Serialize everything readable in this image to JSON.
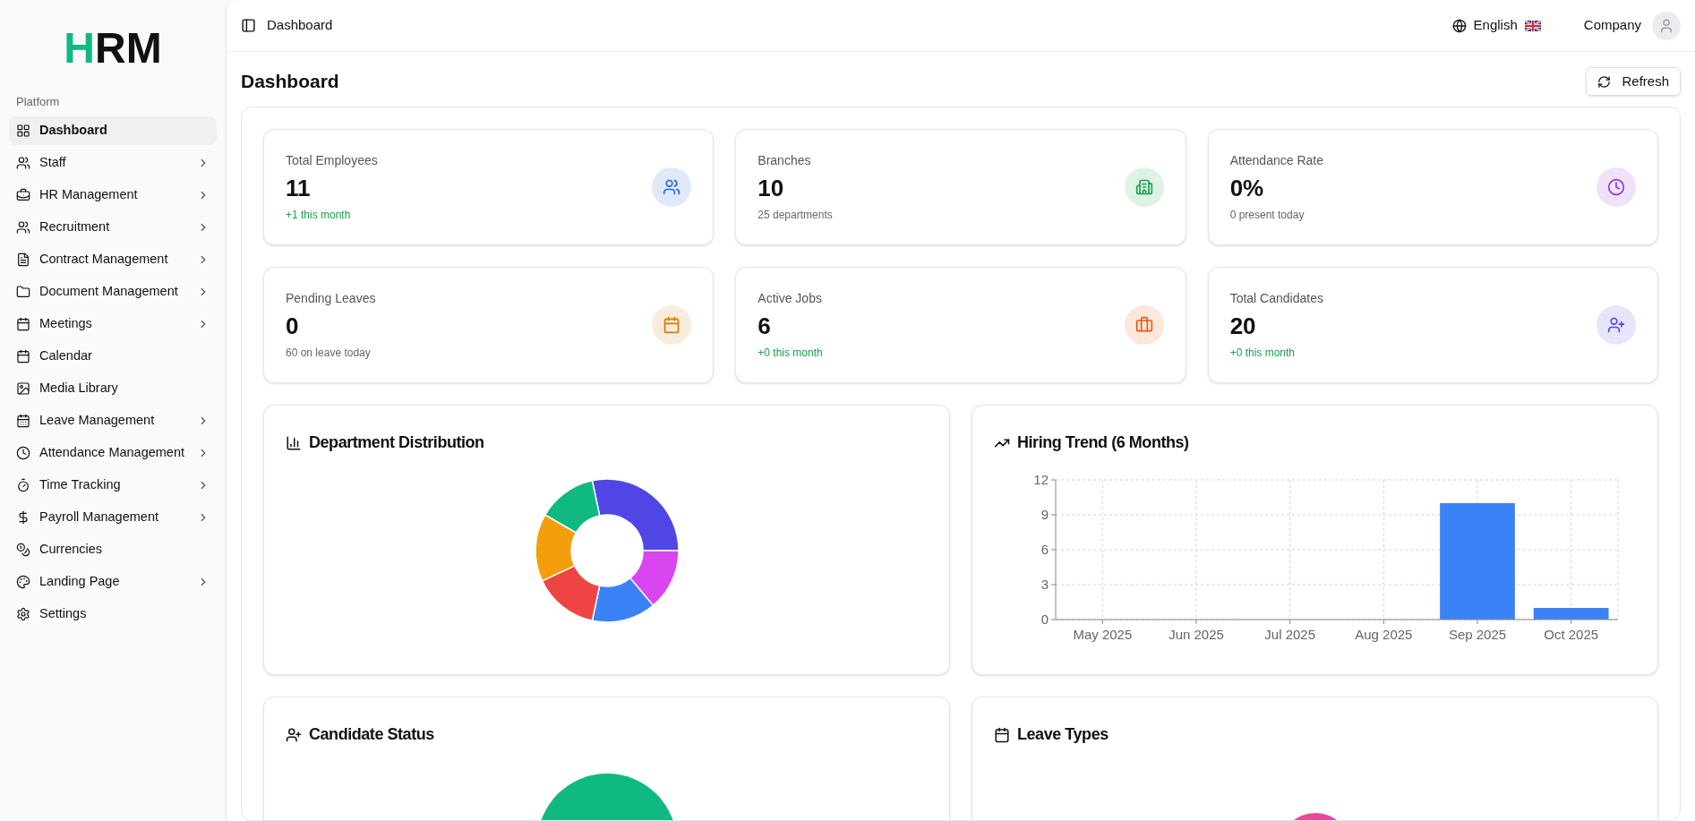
{
  "logo": {
    "first": "H",
    "rest": "RM"
  },
  "sidebar": {
    "section": "Platform",
    "items": [
      {
        "label": "Dashboard",
        "selected": true,
        "expandable": false
      },
      {
        "label": "Staff",
        "selected": false,
        "expandable": true
      },
      {
        "label": "HR Management",
        "selected": false,
        "expandable": true
      },
      {
        "label": "Recruitment",
        "selected": false,
        "expandable": true
      },
      {
        "label": "Contract Management",
        "selected": false,
        "expandable": true
      },
      {
        "label": "Document Management",
        "selected": false,
        "expandable": true
      },
      {
        "label": "Meetings",
        "selected": false,
        "expandable": true
      },
      {
        "label": "Calendar",
        "selected": false,
        "expandable": false
      },
      {
        "label": "Media Library",
        "selected": false,
        "expandable": false
      },
      {
        "label": "Leave Management",
        "selected": false,
        "expandable": true
      },
      {
        "label": "Attendance Management",
        "selected": false,
        "expandable": true
      },
      {
        "label": "Time Tracking",
        "selected": false,
        "expandable": true
      },
      {
        "label": "Payroll Management",
        "selected": false,
        "expandable": true
      },
      {
        "label": "Currencies",
        "selected": false,
        "expandable": false
      },
      {
        "label": "Landing Page",
        "selected": false,
        "expandable": true
      },
      {
        "label": "Settings",
        "selected": false,
        "expandable": false
      }
    ]
  },
  "header": {
    "breadcrumb": "Dashboard",
    "language": "English",
    "account": "Company"
  },
  "page": {
    "title": "Dashboard",
    "refresh": "Refresh"
  },
  "stats": [
    {
      "title": "Total Employees",
      "value": "11",
      "note": "+1 this month",
      "highlight": true,
      "color": "#2563eb"
    },
    {
      "title": "Branches",
      "value": "10",
      "note": "25 departments",
      "highlight": false,
      "color": "#16a34a"
    },
    {
      "title": "Attendance Rate",
      "value": "0%",
      "note": "0 present today",
      "highlight": false,
      "color": "#9333ea"
    },
    {
      "title": "Pending Leaves",
      "value": "0",
      "note": "60 on leave today",
      "highlight": false,
      "color": "#d97706"
    },
    {
      "title": "Active Jobs",
      "value": "6",
      "note": "+0 this month",
      "highlight": true,
      "color": "#ea580c"
    },
    {
      "title": "Total Candidates",
      "value": "20",
      "note": "+0 this month",
      "highlight": true,
      "color": "#4f46e5"
    }
  ],
  "department_distribution": {
    "title": "Department Distribution"
  },
  "hiring_trend": {
    "title": "Hiring Trend (6 Months)",
    "chart_data": {
      "type": "bar",
      "categories": [
        "May 2025",
        "Jun 2025",
        "Jul 2025",
        "Aug 2025",
        "Sep 2025",
        "Oct 2025"
      ],
      "series": [
        {
          "color": "#3b82f6",
          "values": [
            0,
            0,
            0,
            0,
            10,
            1
          ]
        }
      ],
      "grid": true,
      "ylim": [
        0,
        12
      ],
      "yticks": [
        0,
        3,
        6,
        9,
        12
      ]
    }
  },
  "candidate_status": {
    "title": "Candidate Status"
  },
  "leave_types": {
    "title": "Leave Types"
  }
}
